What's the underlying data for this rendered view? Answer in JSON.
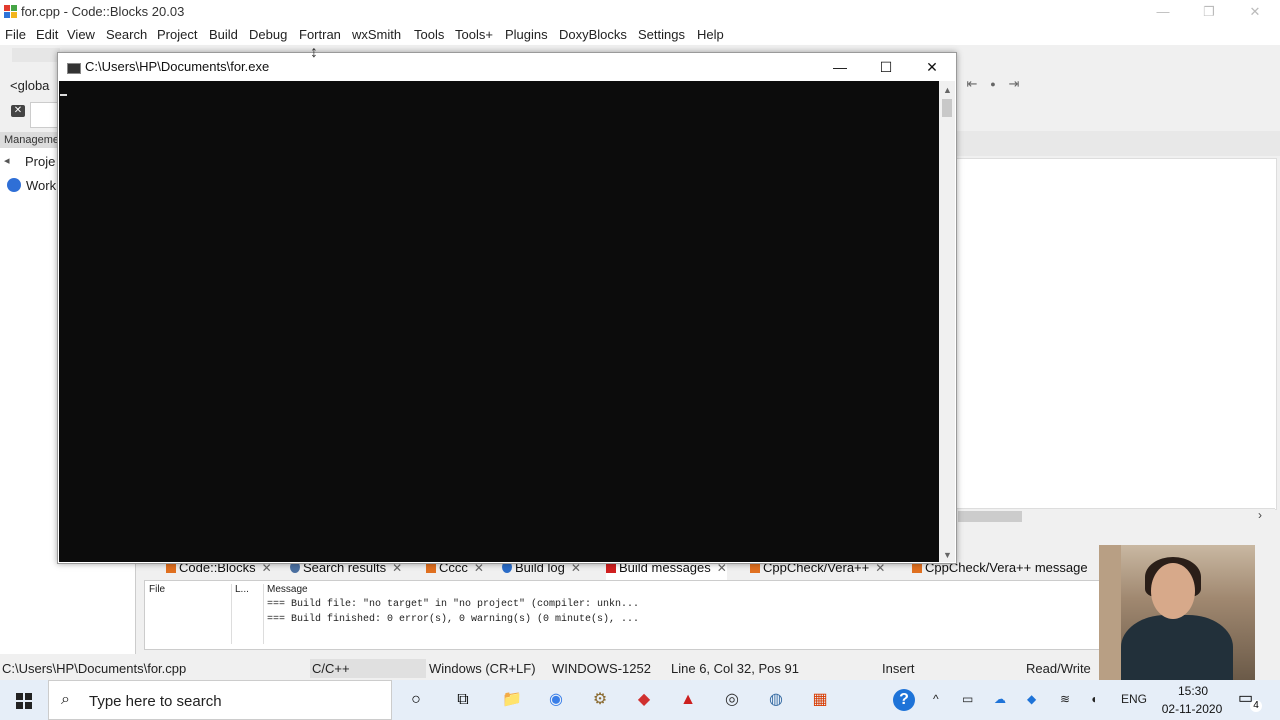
{
  "app": {
    "title": "for.cpp - Code::Blocks 20.03",
    "window_controls": {
      "minimize": "—",
      "restore": "❐",
      "close": "✕"
    }
  },
  "menu": [
    "File",
    "Edit",
    "View",
    "Search",
    "Project",
    "Build",
    "Debug",
    "Fortran",
    "wxSmith",
    "Tools",
    "Tools+",
    "Plugins",
    "DoxyBlocks",
    "Settings",
    "Help"
  ],
  "toolbar": {
    "global_combo": "<globa",
    "clear_icon": "✕",
    "nav_back": "⇤",
    "nav_dot": "●",
    "nav_forward": "⇥"
  },
  "management": {
    "header": "Manageme",
    "tab_arrow": "◂",
    "tab_label": "Proje",
    "workspace_label": "Work"
  },
  "editor": {
    "scroll_right": "›"
  },
  "console": {
    "title": "C:\\Users\\HP\\Documents\\for.exe",
    "minimize": "—",
    "maximize": "☐",
    "close": "✕",
    "scroll_up": "▲",
    "scroll_down": "▼"
  },
  "logs": {
    "tabs": [
      {
        "label": "Code::Blocks",
        "icon_color": "#e07020"
      },
      {
        "label": "Search results",
        "icon_color": "#4a6fa0"
      },
      {
        "label": "Cccc",
        "icon_color": "#e07020"
      },
      {
        "label": "Build log",
        "icon_color": "#2a6cc8"
      },
      {
        "label": "Build messages",
        "icon_color": "#d02020"
      },
      {
        "label": "CppCheck/Vera++",
        "icon_color": "#e07020"
      },
      {
        "label": "CppCheck/Vera++ message",
        "icon_color": "#e07020"
      }
    ],
    "tab_close": "✕",
    "columns": {
      "file": "File",
      "line": "L...",
      "message": "Message"
    },
    "rows": [
      "=== Build file: \"no target\" in \"no project\" (compiler: unkn...",
      "=== Build finished: 0 error(s), 0 warning(s) (0 minute(s), ..."
    ]
  },
  "status": {
    "path": "C:\\Users\\HP\\Documents\\for.cpp",
    "language": "C/C++",
    "eol": "Windows (CR+LF)",
    "encoding": "WINDOWS-1252",
    "position": "Line 6, Col 32, Pos 91",
    "mode": "Insert",
    "access": "Read/Write"
  },
  "taskbar": {
    "search_placeholder": "Type here to search",
    "search_icon": "⌕",
    "cortana_icon": "○",
    "taskview_icon": "⧉",
    "icons": [
      "📁",
      "◉",
      "⚙",
      "◆",
      "▲",
      "◎",
      "◍",
      "▦"
    ],
    "help_icon": "?",
    "tray": {
      "chevron": "^",
      "lang": "ENG",
      "time": "15:30",
      "date": "02-11-2020",
      "notifications": "4"
    }
  }
}
